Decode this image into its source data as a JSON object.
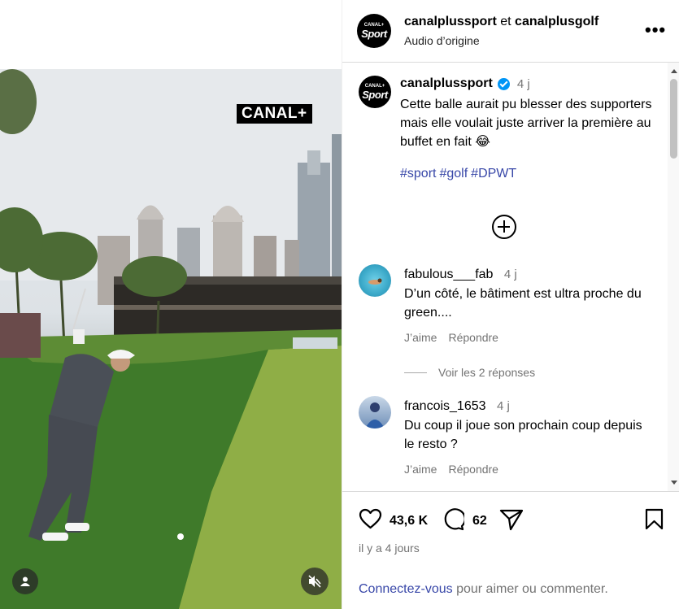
{
  "media": {
    "overlay_logo": "CANAL+",
    "user_icon": "user-icon",
    "mute_icon": "speaker-muted-icon"
  },
  "header": {
    "avatar_top": "CANAL+",
    "avatar_bottom": "Sport",
    "user1": "canalplussport",
    "connector": " et ",
    "user2": "canalplusgolf",
    "audio": "Audio d’origine",
    "more_icon": "more-options-icon"
  },
  "caption": {
    "username": "canalplussport",
    "time": "4 j",
    "text": "Cette balle aurait pu blesser des supporters mais elle voulait juste arriver la première au buffet en fait 😂",
    "hashtags": [
      "#sport",
      "#golf",
      "#DPWT"
    ]
  },
  "comments": [
    {
      "username": "fabulous___fab",
      "time": "4 j",
      "text": "D’un côté, le bâtiment est ultra proche du green....",
      "like_label": "J’aime",
      "reply_label": "Répondre",
      "view_replies": "Voir les 2 réponses"
    },
    {
      "username": "francois_1653",
      "time": "4 j",
      "text": "Du coup il joue son prochain coup depuis le resto ?",
      "like_label": "J’aime",
      "reply_label": "Répondre"
    }
  ],
  "actions": {
    "likes": "43,6 K",
    "comments": "62",
    "posted": "il y a 4 jours"
  },
  "footer": {
    "login_link": "Connectez-vous",
    "login_rest": " pour aimer ou commenter."
  },
  "colors": {
    "link": "#3847a8",
    "verified": "#0095f6",
    "muted_text": "#737373"
  }
}
